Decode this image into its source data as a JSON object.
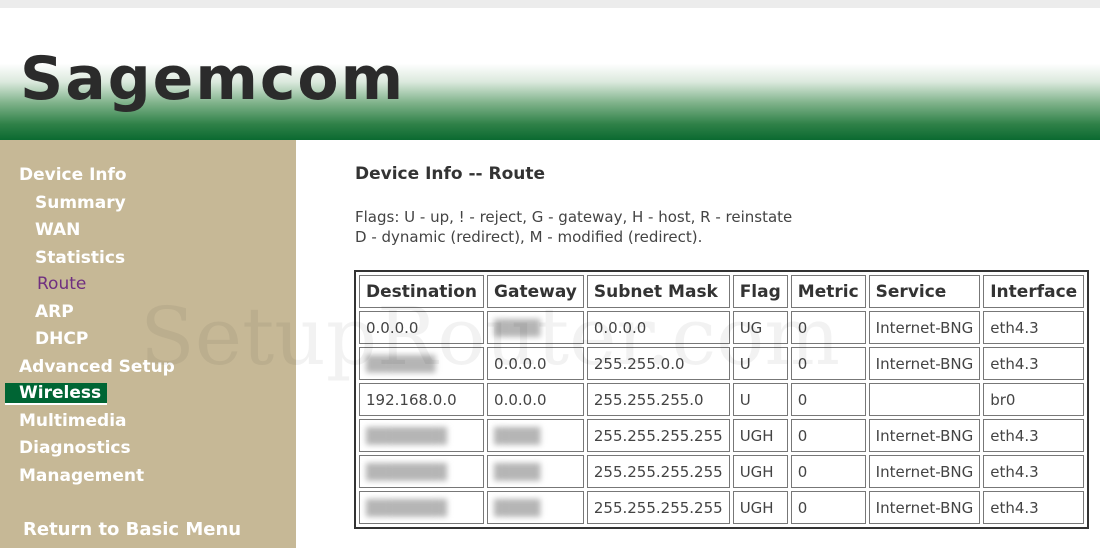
{
  "brand": {
    "logo_text": "Sagemcom"
  },
  "sidebar": {
    "items": [
      {
        "label": "Device Info"
      },
      {
        "label": "Summary"
      },
      {
        "label": "WAN"
      },
      {
        "label": "Statistics"
      },
      {
        "label": "Route"
      },
      {
        "label": "ARP"
      },
      {
        "label": "DHCP"
      },
      {
        "label": "Advanced Setup"
      },
      {
        "label": "Wireless"
      },
      {
        "label": "Multimedia"
      },
      {
        "label": "Diagnostics"
      },
      {
        "label": "Management"
      }
    ],
    "return_label": "Return to Basic Menu"
  },
  "main": {
    "title": "Device Info -- Route",
    "flags_line1": "Flags: U - up, ! - reject, G - gateway, H - host, R - reinstate",
    "flags_line2": "D - dynamic (redirect), M - modified (redirect)."
  },
  "table": {
    "headers": [
      "Destination",
      "Gateway",
      "Subnet Mask",
      "Flag",
      "Metric",
      "Service",
      "Interface"
    ],
    "rows": [
      [
        "0.0.0.0",
        "",
        "0.0.0.0",
        "UG",
        "0",
        "Internet-BNG",
        "eth4.3"
      ],
      [
        "",
        "0.0.0.0",
        "255.255.0.0",
        "U",
        "0",
        "Internet-BNG",
        "eth4.3"
      ],
      [
        "192.168.0.0",
        "0.0.0.0",
        "255.255.255.0",
        "U",
        "0",
        "",
        "br0"
      ],
      [
        "",
        "",
        "255.255.255.255",
        "UGH",
        "0",
        "Internet-BNG",
        "eth4.3"
      ],
      [
        "",
        "",
        "255.255.255.255",
        "UGH",
        "0",
        "Internet-BNG",
        "eth4.3"
      ],
      [
        "",
        "",
        "255.255.255.255",
        "UGH",
        "0",
        "Internet-BNG",
        "eth4.3"
      ]
    ]
  },
  "watermark": "SetupRouter.com",
  "colors": {
    "sidebar_bg": "#c6b896",
    "selected_bg": "#006534",
    "current_link": "#6f2f80",
    "banner_green": "#0b6a31"
  }
}
